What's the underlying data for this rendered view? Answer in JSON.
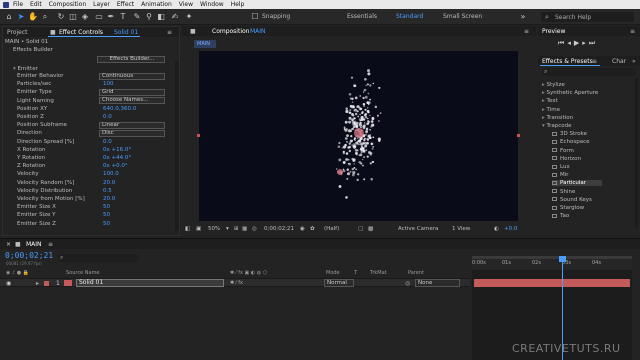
{
  "menubar": [
    "File",
    "Edit",
    "Composition",
    "Layer",
    "Effect",
    "Animation",
    "View",
    "Window",
    "Help"
  ],
  "toolbar": {
    "snapping": "Snapping",
    "workspaces": [
      "Essentials",
      "Standard",
      "Small Screen"
    ],
    "active_workspace": "Standard",
    "search_placeholder": "Search Help"
  },
  "effect_controls": {
    "project_tab": "Project",
    "tab_label": "Effect Controls",
    "tab_layer": "Solid 01",
    "breadcrumb": "MAIN • Solid 01",
    "effect_name": "Effects Builder",
    "effects_builder_button": "Effects Builder...",
    "section": "Emitter",
    "rows": [
      {
        "label": "Emitter Behavior",
        "value": "Continuous",
        "kind": "dropdown"
      },
      {
        "label": "Particles/sec",
        "value": "100",
        "kind": "value"
      },
      {
        "label": "Emitter Type",
        "value": "Grid",
        "kind": "dropdown"
      },
      {
        "label": "Light Naming",
        "value": "Choose Names...",
        "kind": "dropdown"
      },
      {
        "label": "Position XY",
        "value": "640.0,360.0",
        "kind": "value"
      },
      {
        "label": "Position Z",
        "value": "0.0",
        "kind": "value"
      },
      {
        "label": "Position Subframe",
        "value": "Linear",
        "kind": "dropdown"
      },
      {
        "label": "Direction",
        "value": "Disc",
        "kind": "dropdown"
      },
      {
        "label": "Direction Spread [%]",
        "value": "0.0",
        "kind": "value"
      },
      {
        "label": "X Rotation",
        "value": "0x +16.0°",
        "kind": "value"
      },
      {
        "label": "Y Rotation",
        "value": "0x +44.0°",
        "kind": "value"
      },
      {
        "label": "Z Rotation",
        "value": "0x +0.0°",
        "kind": "value"
      },
      {
        "label": "Velocity",
        "value": "100.0",
        "kind": "value"
      },
      {
        "label": "Velocity Random [%]",
        "value": "20.0",
        "kind": "value"
      },
      {
        "label": "Velocity Distribution",
        "value": "0.5",
        "kind": "value"
      },
      {
        "label": "Velocity from Motion [%]",
        "value": "20.0",
        "kind": "value"
      },
      {
        "label": "Emitter Size X",
        "value": "50",
        "kind": "value"
      },
      {
        "label": "Emitter Size Y",
        "value": "50",
        "kind": "value"
      },
      {
        "label": "Emitter Size Z",
        "value": "50",
        "kind": "value"
      }
    ]
  },
  "composition": {
    "tab_label": "Composition",
    "tab_name": "MAIN",
    "sub_tab": "MAIN",
    "zoom": "50%",
    "timecode": "0;00;02;21",
    "resolution": "(Half)",
    "camera": "Active Camera",
    "views": "1 View",
    "exposure": "+0.0"
  },
  "preview": {
    "title": "Preview"
  },
  "effects_presets": {
    "title": "Effects & Presets",
    "tab2": "Char",
    "categories": [
      "Stylize",
      "Synthetic Aperture",
      "Text",
      "Time",
      "Transition"
    ],
    "open_category": "Trapcode",
    "items": [
      "3D Stroke",
      "Echospace",
      "Form",
      "Horizon",
      "Lux",
      "Mir",
      "Particular",
      "Shine",
      "Sound Keys",
      "Starglow",
      "Tao"
    ],
    "selected": "Particular"
  },
  "timeline": {
    "tab_name": "MAIN",
    "timecode": "0;00;02;21",
    "frames": "00081 (29.97 fps)",
    "columns": {
      "source": "Source Name",
      "mode": "Mode",
      "trkmat": "TrkMat",
      "parent": "Parent"
    },
    "layer": {
      "index": "1",
      "name": "Solid 01",
      "mode": "Normal",
      "parent": "None"
    },
    "ruler": [
      "0:00s",
      "01s",
      "02s",
      "03s",
      "04s"
    ],
    "playhead_fraction": 0.56
  },
  "watermark": "CREATIVETUTS.RU",
  "colors": {
    "accent": "#4a9eff",
    "layer_bar": "#c45a5a",
    "viewer_bg": "#0a0b18"
  }
}
